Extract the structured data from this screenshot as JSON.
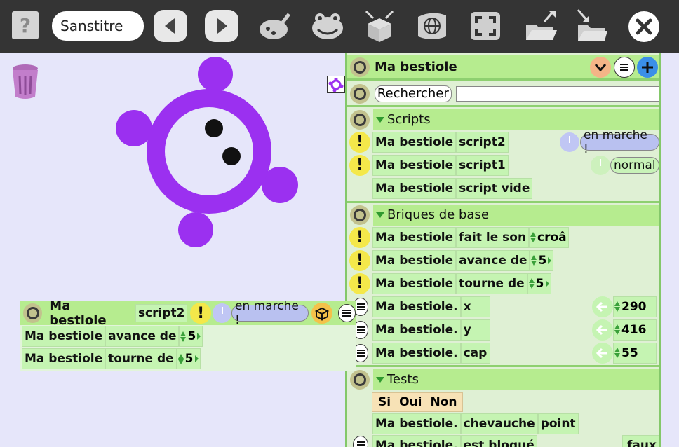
{
  "toolbar": {
    "help_label": "?",
    "title": "Sanstitre",
    "icons": [
      "help-icon",
      "prev-arrow-icon",
      "next-arrow-icon",
      "paint-icon",
      "frog-icon",
      "box-icon",
      "globe-icon",
      "fullscreen-icon",
      "open-folder-icon",
      "save-folder-icon",
      "close-icon"
    ]
  },
  "panel": {
    "object_name": "Ma bestiole",
    "search_label": "Rechercher",
    "search_value": "",
    "sections": {
      "scripts": "Scripts",
      "basics": "Briques de base",
      "tests": "Tests"
    },
    "scripts": [
      {
        "obj": "Ma bestiole",
        "name": "script2",
        "status": "en marche !"
      },
      {
        "obj": "Ma bestiole",
        "name": "script1",
        "status": "normal"
      },
      {
        "obj": "Ma bestiole",
        "name": "script vide"
      }
    ],
    "basics": [
      {
        "obj": "Ma bestiole",
        "verb": "fait le son",
        "value": "croâ"
      },
      {
        "obj": "Ma bestiole",
        "verb": "avance de",
        "value": "5"
      },
      {
        "obj": "Ma bestiole",
        "verb": "tourne de",
        "value": "5"
      },
      {
        "obj": "Ma bestiole.",
        "verb": "x",
        "value": "290"
      },
      {
        "obj": "Ma bestiole.",
        "verb": "y",
        "value": "416"
      },
      {
        "obj": "Ma bestiole.",
        "verb": "cap",
        "value": "55"
      }
    ],
    "tests": {
      "if_block": [
        "Si",
        "Oui",
        "Non"
      ],
      "overlap": {
        "obj": "Ma bestiole.",
        "verb": "chevauche",
        "arg": "point"
      },
      "blocked": {
        "obj": "Ma bestiole.",
        "verb": "est bloqué",
        "value": "faux"
      }
    }
  },
  "script_window": {
    "obj": "Ma bestiole",
    "name": "script2",
    "status": "en marche !",
    "lines": [
      {
        "obj": "Ma bestiole",
        "verb": "avance de",
        "value": "5"
      },
      {
        "obj": "Ma bestiole",
        "verb": "tourne de",
        "value": "5"
      }
    ]
  },
  "colors": {
    "toolbar": "#343434",
    "stage": "#e6e6fa",
    "creature": "#9b30f0",
    "block": "#c5f4b2",
    "panel_header": "#b6ec8f"
  }
}
